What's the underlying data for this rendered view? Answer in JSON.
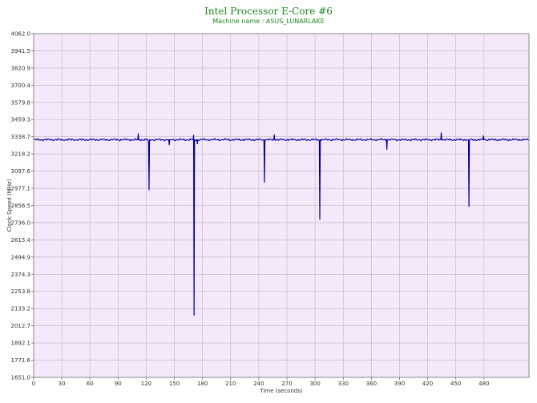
{
  "chart_data": {
    "type": "line",
    "title": "Intel Processor E-Core #6",
    "subtitle": "Machine name : ASUS_LUNARLAKE",
    "xlabel": "Time (seconds)",
    "ylabel": "Clock Speed (MHz)",
    "xlim": [
      0,
      528
    ],
    "ylim": [
      1651.0,
      4062.0
    ],
    "x_ticks": [
      "0",
      "30",
      "60",
      "90",
      "120",
      "150",
      "180",
      "210",
      "240",
      "270",
      "300",
      "330",
      "360",
      "390",
      "420",
      "450",
      "480"
    ],
    "y_ticks": [
      "1651.0",
      "1771.6",
      "1892.1",
      "2012.7",
      "2133.2",
      "2253.8",
      "2374.3",
      "2494.9",
      "2615.4",
      "2736.0",
      "2856.5",
      "2977.1",
      "3097.6",
      "3218.2",
      "3338.7",
      "3459.3",
      "3579.8",
      "3700.4",
      "3820.9",
      "3941.5",
      "4062.0"
    ],
    "grid": true,
    "line_color": "#0000a0",
    "plot_background": "#f6e8fb",
    "baseline": 3318,
    "series": [
      {
        "values": [
          [
            0,
            3318
          ],
          [
            111,
            3318
          ],
          [
            111.5,
            3360
          ],
          [
            112,
            3318
          ],
          [
            122,
            3318
          ],
          [
            122.5,
            3290
          ],
          [
            123,
            2966
          ],
          [
            123.5,
            3318
          ],
          [
            144,
            3318
          ],
          [
            144.5,
            3282
          ],
          [
            145,
            3318
          ],
          [
            170,
            3318
          ],
          [
            170.5,
            3350
          ],
          [
            171,
            2087
          ],
          [
            171.5,
            3318
          ],
          [
            174,
            3318
          ],
          [
            174.5,
            3290
          ],
          [
            175,
            3318
          ],
          [
            245,
            3318
          ],
          [
            245.5,
            3310
          ],
          [
            246,
            3020
          ],
          [
            246.5,
            3318
          ],
          [
            256,
            3318
          ],
          [
            256.5,
            3352
          ],
          [
            257,
            3318
          ],
          [
            304,
            3318
          ],
          [
            304.5,
            3310
          ],
          [
            305,
            2760
          ],
          [
            305.5,
            3318
          ],
          [
            376,
            3318
          ],
          [
            376.5,
            3250
          ],
          [
            377,
            3318
          ],
          [
            434,
            3318
          ],
          [
            434.5,
            3366
          ],
          [
            435,
            3318
          ],
          [
            463,
            3318
          ],
          [
            463.5,
            3310
          ],
          [
            464,
            2850
          ],
          [
            464.5,
            3318
          ],
          [
            479,
            3318
          ],
          [
            479.5,
            3345
          ],
          [
            480,
            3318
          ],
          [
            528,
            3318
          ]
        ]
      }
    ]
  }
}
